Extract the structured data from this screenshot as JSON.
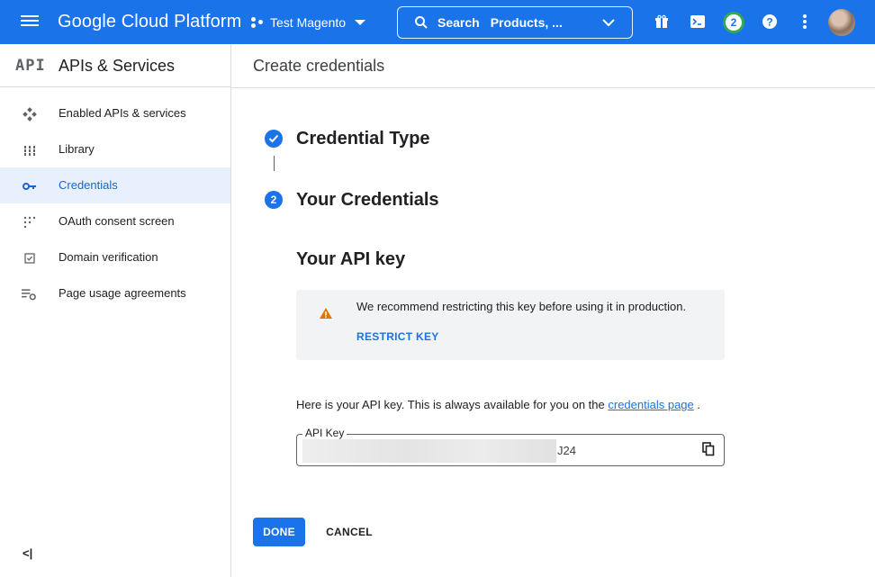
{
  "topbar": {
    "brand": "Google Cloud Platform",
    "project": "Test Magento",
    "search_label": "Search",
    "search_placeholder": "Products, ...",
    "notification_count": "2",
    "accent": "#1a73e8"
  },
  "sidebar": {
    "logo": "API",
    "title": "APIs & Services",
    "items": [
      {
        "label": "Enabled APIs & services",
        "icon": "enabled-apis-icon"
      },
      {
        "label": "Library",
        "icon": "library-icon"
      },
      {
        "label": "Credentials",
        "icon": "key-icon",
        "active": true
      },
      {
        "label": "OAuth consent screen",
        "icon": "oauth-icon"
      },
      {
        "label": "Domain verification",
        "icon": "checkbox-icon"
      },
      {
        "label": "Page usage agreements",
        "icon": "settings-list-icon"
      }
    ],
    "collapse": "<|"
  },
  "main": {
    "title": "Create credentials",
    "steps": [
      {
        "number": "✓",
        "title": "Credential Type"
      },
      {
        "number": "2",
        "title": "Your Credentials"
      }
    ],
    "api_key_heading": "Your API key",
    "warning": {
      "text": "We recommend restricting this key before using it in production.",
      "action": "RESTRICT KEY"
    },
    "info_prefix": "Here is your API key. This is always available for you on the ",
    "info_link": "credentials page",
    "info_suffix": " .",
    "key_field": {
      "label": "API Key",
      "visible_suffix": "J24"
    },
    "buttons": {
      "done": "DONE",
      "cancel": "CANCEL"
    }
  }
}
